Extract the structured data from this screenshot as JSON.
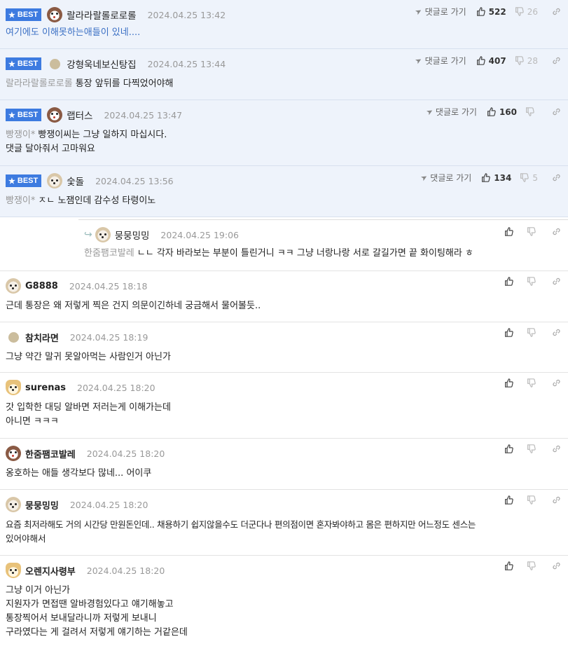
{
  "labels": {
    "best": "BEST",
    "goto": "댓글로 가기"
  },
  "comments": [
    {
      "best": true,
      "nick": "랄라라랄롤로로롤",
      "avatar": "dog-avatar-icon",
      "time": "2024.04.25 13:42",
      "likes": "522",
      "dislikes": "26",
      "reply_to": "",
      "lines": [
        "여기에도 이해못하는애들이 있네...."
      ]
    },
    {
      "best": true,
      "nick": "강형욱네보신탕집",
      "avatar": "circle-avatar-icon",
      "time": "2024.04.25 13:44",
      "likes": "407",
      "dislikes": "28",
      "reply_to": "랄라라랄롤로로롤",
      "lines": [
        "통장 앞뒤를 다찍었어야해"
      ]
    },
    {
      "best": true,
      "nick": "랩터스",
      "avatar": "dog-avatar-icon",
      "time": "2024.04.25 13:47",
      "likes": "160",
      "dislikes": "",
      "reply_to": "빵쟁이*",
      "lines": [
        "빵쟁이씨는 그냥 일하지 마십시다.",
        "댓글 달아줘서 고마워요"
      ]
    },
    {
      "best": true,
      "nick": "숯돌",
      "avatar": "puppy-avatar-icon",
      "time": "2024.04.25 13:56",
      "likes": "134",
      "dislikes": "5",
      "reply_to": "빵쟁이*",
      "lines": [
        "ㅈㄴ 노잼인데 감수성 타령이노"
      ]
    },
    {
      "best": false,
      "nested": true,
      "nick": "뭉뭉밍밍",
      "avatar": "puppy-avatar-icon",
      "time": "2024.04.25 19:06",
      "reply_to": "한줌팸코발레",
      "lines": [
        "ㄴㄴ 각자 바라보는 부분이 틀린거니 ㅋㅋ 그냥 너랑나랑 서로 갈길가면 끝 화이팅해라 ㅎ"
      ]
    },
    {
      "best": false,
      "nick": "G8888",
      "avatar": "puppy-avatar-icon",
      "time": "2024.04.25 18:18",
      "reply_to": "",
      "lines": [
        "근데 통장은 왜 저렇게 찍은 건지 의문이긴하네 궁금해서 물어볼듯.."
      ]
    },
    {
      "best": false,
      "nick": "참치라면",
      "avatar": "circle-avatar-icon",
      "time": "2024.04.25 18:19",
      "reply_to": "",
      "lines": [
        "그냥 약간 말귀 못알아먹는 사람인거 아닌가"
      ]
    },
    {
      "best": false,
      "nick": "surenas",
      "avatar": "fox-avatar-icon",
      "time": "2024.04.25 18:20",
      "reply_to": "",
      "lines": [
        "갓 입학한 대딩 알바면 저러는게 이해가는데",
        "아니면 ㅋㅋㅋ"
      ]
    },
    {
      "best": false,
      "nick": "한줌팸코발레",
      "avatar": "dog-avatar-icon",
      "time": "2024.04.25 18:20",
      "reply_to": "",
      "lines": [
        "옹호하는 애들 생각보다 많네... 어이쿠"
      ]
    },
    {
      "best": false,
      "nick": "뭉뭉밍밍",
      "avatar": "puppy-avatar-icon",
      "time": "2024.04.25 18:20",
      "reply_to": "",
      "lines": [
        "요즘 최저라해도 거의 시간당 만원돈인데.. 채용하기 쉽지않을수도 더군다나 편의점이면 혼자봐야하고 몸은 편하지만 어느정도 센스는",
        "있어야해서"
      ]
    },
    {
      "best": false,
      "nick": "오렌지사령부",
      "avatar": "fox-avatar-icon",
      "time": "2024.04.25 18:20",
      "reply_to": "",
      "lines": [
        "그냥 이거 아닌가",
        "지원자가 면접땐 알바경험있다고 얘기해놓고",
        "통장찍어서 보내달라니까 저렇게 보내니",
        "구라였다는 게 걸려서 저렇게 얘기하는 거같은데"
      ]
    }
  ]
}
